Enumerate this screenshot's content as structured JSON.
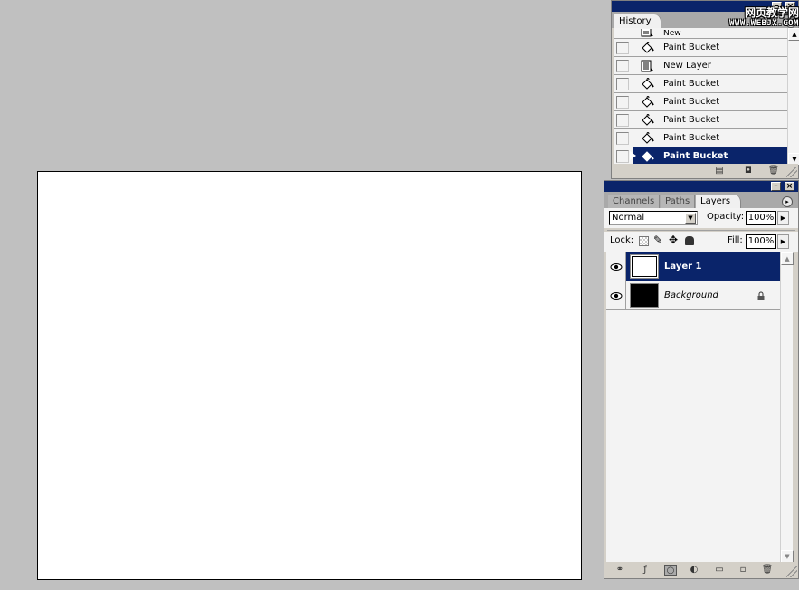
{
  "canvas": {
    "background": "#ffffff"
  },
  "watermark": {
    "line1": "网页教学网",
    "line2": "WWW.WEBJX.COM"
  },
  "history": {
    "tab": "History",
    "items": [
      {
        "label": "New",
        "icon": "new-doc-icon",
        "selected": false
      },
      {
        "label": "Paint Bucket",
        "icon": "paint-bucket-icon",
        "selected": false
      },
      {
        "label": "New Layer",
        "icon": "new-layer-icon",
        "selected": false
      },
      {
        "label": "Paint Bucket",
        "icon": "paint-bucket-icon",
        "selected": false
      },
      {
        "label": "Paint Bucket",
        "icon": "paint-bucket-icon",
        "selected": false
      },
      {
        "label": "Paint Bucket",
        "icon": "paint-bucket-icon",
        "selected": false
      },
      {
        "label": "Paint Bucket",
        "icon": "paint-bucket-icon",
        "selected": false
      },
      {
        "label": "Paint Bucket",
        "icon": "paint-bucket-icon",
        "selected": true
      }
    ],
    "footer": [
      "new-document-from-state-icon",
      "create-snapshot-icon",
      "delete-state-icon"
    ]
  },
  "layers_panel": {
    "tabs": [
      {
        "label": "Channels",
        "active": false
      },
      {
        "label": "Paths",
        "active": false
      },
      {
        "label": "Layers",
        "active": true
      }
    ],
    "blend_mode": "Normal",
    "opacity_label": "Opacity:",
    "opacity_value": "100%",
    "lock_label": "Lock:",
    "fill_label": "Fill:",
    "fill_value": "100%",
    "layers": [
      {
        "name": "Layer 1",
        "visible": true,
        "selected": true,
        "thumb_color": "#ffffff",
        "locked": false
      },
      {
        "name": "Background",
        "visible": true,
        "selected": false,
        "thumb_color": "#000000",
        "locked": true
      }
    ],
    "footer": [
      "link-layers-icon",
      "layer-style-icon",
      "add-mask-icon",
      "adjustment-layer-icon",
      "new-group-icon",
      "new-layer-icon",
      "delete-layer-icon"
    ]
  },
  "colors": {
    "selection": "#0a246a",
    "panel_bg": "#d4d0c8",
    "workspace": "#c0c0c0"
  }
}
